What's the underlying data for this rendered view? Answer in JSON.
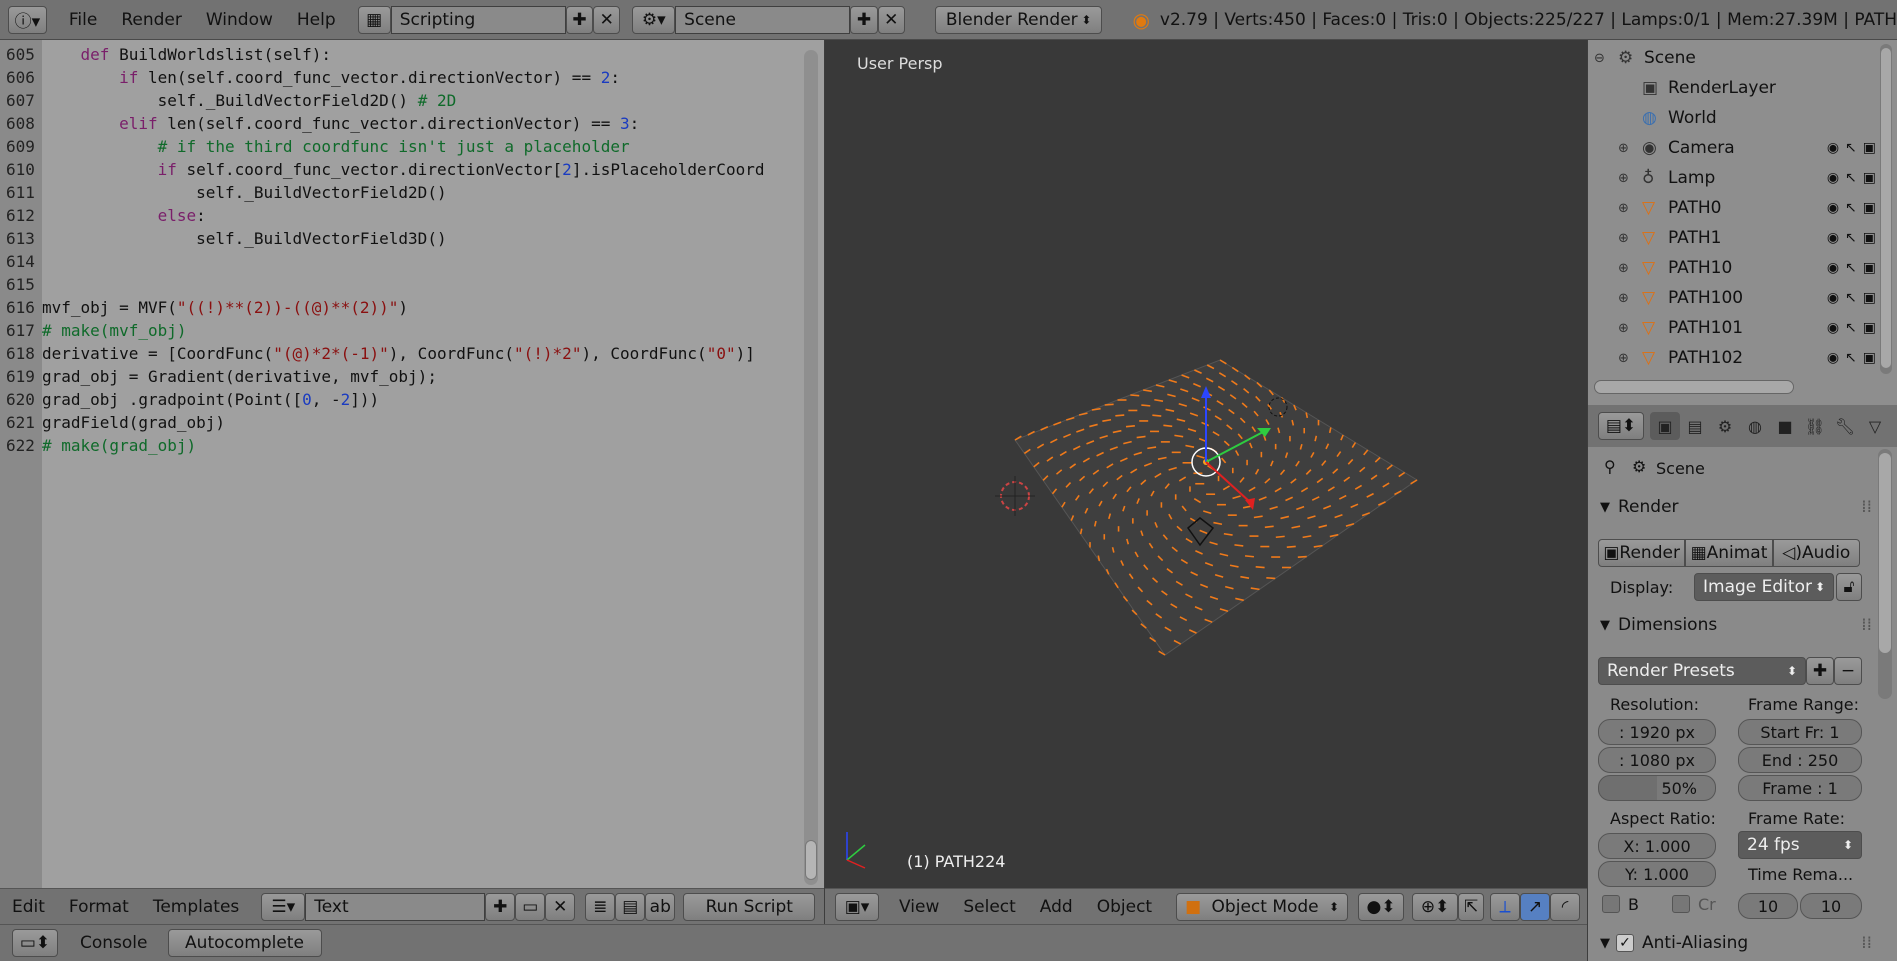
{
  "topbar": {
    "menus": [
      "File",
      "Render",
      "Window",
      "Help"
    ],
    "screen_layout": "Scripting",
    "scene": "Scene",
    "engine": "Blender Render",
    "stats": "v2.79 | Verts:450 | Faces:0 | Tris:0 | Objects:225/227 | Lamps:0/1 | Mem:27.39M | PATH"
  },
  "editor": {
    "lines": [
      {
        "n": "605",
        "html": "    <span class=\"kw\">def</span> BuildWorldslist(self):"
      },
      {
        "n": "606",
        "html": "        <span class=\"kw\">if</span> len(self.coord_func_vector.directionVector) == <span class=\"num\">2</span>:"
      },
      {
        "n": "607",
        "html": "            self._BuildVectorField2D() <span class=\"cmt\"># 2D</span>"
      },
      {
        "n": "608",
        "html": "        <span class=\"kw\">elif</span> len(self.coord_func_vector.directionVector) == <span class=\"num\">3</span>:"
      },
      {
        "n": "609",
        "html": "            <span class=\"cmt\"># if the third coordfunc isn't just a placeholder</span>"
      },
      {
        "n": "610",
        "html": "            <span class=\"kw\">if</span> self.coord_func_vector.directionVector[<span class=\"num\">2</span>].isPlaceholderCoord"
      },
      {
        "n": "611",
        "html": "                self._BuildVectorField2D()"
      },
      {
        "n": "612",
        "html": "            <span class=\"kw\">else</span>:"
      },
      {
        "n": "613",
        "html": "                self._BuildVectorField3D()"
      },
      {
        "n": "614",
        "html": ""
      },
      {
        "n": "615",
        "html": ""
      },
      {
        "n": "616",
        "html": "mvf_obj = MVF(<span class=\"str\">\"((!)**(2))-((@)**(2))\"</span>)"
      },
      {
        "n": "617",
        "html": "<span class=\"cmt\"># make(mvf_obj)</span>"
      },
      {
        "n": "618",
        "html": "derivative = [CoordFunc(<span class=\"str\">\"(@)*2*(-1)\"</span>), CoordFunc(<span class=\"str\">\"(!)*2\"</span>), CoordFunc(<span class=\"str\">\"0\"</span>)]"
      },
      {
        "n": "619",
        "html": "grad_obj = Gradient(derivative, mvf_obj);"
      },
      {
        "n": "620",
        "html": "grad_obj .gradpoint(Point([<span class=\"num\">0</span>, -<span class=\"num\">2</span>]))"
      },
      {
        "n": "621",
        "html": "gradField(grad_obj)"
      },
      {
        "n": "622",
        "html": "<span class=\"cmt\"># make(grad_obj)</span>"
      }
    ],
    "footer": {
      "menus": [
        "Edit",
        "Format",
        "Templates"
      ],
      "text_name": "Text",
      "run_script": "Run Script"
    }
  },
  "viewport": {
    "view_label": "User Persp",
    "object_label": "(1) PATH224",
    "footer_menus": [
      "View",
      "Select",
      "Add",
      "Object"
    ],
    "mode": "Object Mode"
  },
  "outliner": {
    "rows": [
      {
        "label": "Scene",
        "icon": "scene-icon"
      },
      {
        "label": "RenderLayer",
        "icon": "renderlayer-icon"
      },
      {
        "label": "World",
        "icon": "world-icon"
      },
      {
        "label": "Camera",
        "icon": "camera-icon"
      },
      {
        "label": "Lamp",
        "icon": "lamp-icon"
      },
      {
        "label": "PATH0",
        "icon": "mesh-icon"
      },
      {
        "label": "PATH1",
        "icon": "mesh-icon"
      },
      {
        "label": "PATH10",
        "icon": "mesh-icon"
      },
      {
        "label": "PATH100",
        "icon": "mesh-icon"
      },
      {
        "label": "PATH101",
        "icon": "mesh-icon"
      },
      {
        "label": "PATH102",
        "icon": "mesh-icon"
      }
    ]
  },
  "properties": {
    "context": "Scene",
    "render_panel": "Render",
    "render_buttons": [
      "Render",
      "Animat",
      "Audio"
    ],
    "display_label": "Display:",
    "display_value": "Image Editor",
    "dimensions_panel": "Dimensions",
    "presets": "Render Presets",
    "resolution_label": "Resolution:",
    "res_x": ": 1920 px",
    "res_y": ": 1080 px",
    "res_pct": "50%",
    "frame_range_label": "Frame Range:",
    "start": "Start Fr: 1",
    "end": "End : 250",
    "frame": "Frame : 1",
    "aspect_label": "Aspect Ratio:",
    "aspect_x": "X:  1.000",
    "aspect_y": "Y:  1.000",
    "frame_rate_label": "Frame Rate:",
    "fps": "24 fps",
    "time_remap_label": "Time Rema...",
    "border_label": "B",
    "crop_label": "Cr",
    "remap_old": "10",
    "remap_new": "10",
    "antialias_panel": "Anti-Aliasing"
  },
  "bottombar": {
    "console": "Console",
    "autocomplete": "Autocomplete"
  }
}
